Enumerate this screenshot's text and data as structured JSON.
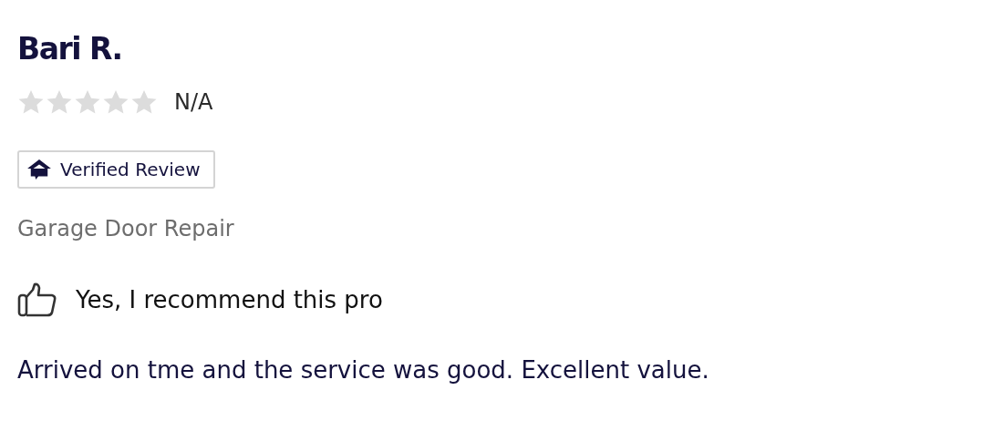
{
  "reviewer": {
    "name": "Bari R.",
    "stars": 0,
    "rating": "N/A"
  },
  "badge": {
    "label": "Verified Review"
  },
  "category": "Garage Door Repair",
  "recommendation": {
    "recommended": true,
    "label": "Yes, I recommend this pro"
  },
  "review_text": "Arrived on tme and the service was good. Excellent value."
}
